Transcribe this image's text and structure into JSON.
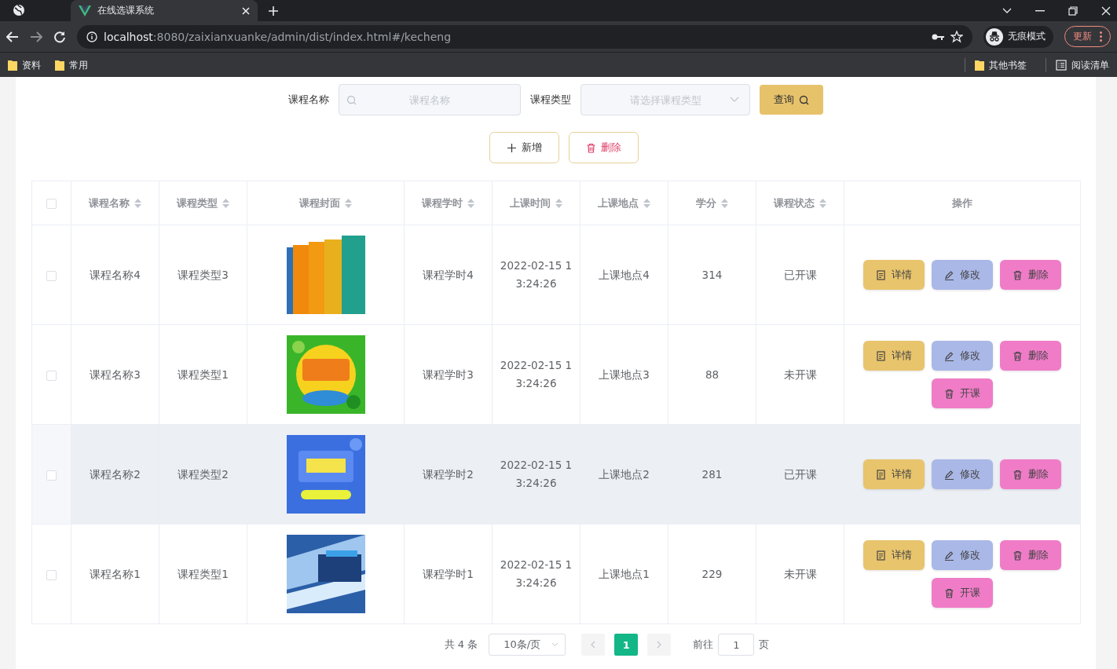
{
  "browser": {
    "tab_title": "在线选课系统",
    "url_host": "localhost",
    "url_path": ":8080/zaixianxuanke/admin/dist/index.html#/kecheng",
    "incognito_label": "无痕模式",
    "update_button": "更新",
    "bookmarks": [
      "资料",
      "常用"
    ],
    "other_bookmarks": "其他书签",
    "reading_list": "阅读清单"
  },
  "search": {
    "fields": [
      {
        "label": "课程名称",
        "placeholder": "课程名称",
        "kind": "text"
      },
      {
        "label": "课程类型",
        "placeholder": "请选择课程类型",
        "kind": "select"
      }
    ],
    "query_button": "查询"
  },
  "actions": [
    {
      "label": "新增",
      "kind": "add"
    },
    {
      "label": "删除",
      "kind": "delete"
    }
  ],
  "table": {
    "select_all": {
      "checked": false
    },
    "columns": [
      {
        "label": "课程名称",
        "kind": "text",
        "sortable": true
      },
      {
        "label": "课程类型",
        "kind": "text",
        "sortable": true
      },
      {
        "label": "课程封面",
        "kind": "picture",
        "sortable": true
      },
      {
        "label": "课程学时",
        "kind": "text",
        "sortable": true
      },
      {
        "label": "上课时间",
        "kind": "text",
        "sortable": true
      },
      {
        "label": "上课地点",
        "kind": "text",
        "sortable": true
      },
      {
        "label": "学分",
        "kind": "text",
        "sortable": true
      },
      {
        "label": "课程状态",
        "kind": "text",
        "sortable": true
      },
      {
        "label": "操作",
        "kind": "actions",
        "sortable": false
      }
    ],
    "rows": [
      {
        "checked": false,
        "highlighted": false,
        "cells": [
          "课程名称4",
          "课程类型3",
          {
            "kind": "picture"
          },
          "课程学时4",
          "2022-02-15 13:24:26",
          "上课地点4",
          "314",
          "已开课"
        ],
        "actions": [
          {
            "label": "详情",
            "kind": "detail"
          },
          {
            "label": "修改",
            "kind": "edit"
          },
          {
            "label": "删除",
            "kind": "delete"
          }
        ]
      },
      {
        "checked": false,
        "highlighted": false,
        "cells": [
          "课程名称3",
          "课程类型1",
          {
            "kind": "picture"
          },
          "课程学时3",
          "2022-02-15 13:24:26",
          "上课地点3",
          "88",
          "未开课"
        ],
        "actions": [
          {
            "label": "详情",
            "kind": "detail"
          },
          {
            "label": "修改",
            "kind": "edit"
          },
          {
            "label": "删除",
            "kind": "delete"
          },
          {
            "label": "开课",
            "kind": "open"
          }
        ]
      },
      {
        "checked": false,
        "highlighted": true,
        "cells": [
          "课程名称2",
          "课程类型2",
          {
            "kind": "picture"
          },
          "课程学时2",
          "2022-02-15 13:24:26",
          "上课地点2",
          "281",
          "已开课"
        ],
        "actions": [
          {
            "label": "详情",
            "kind": "detail"
          },
          {
            "label": "修改",
            "kind": "edit"
          },
          {
            "label": "删除",
            "kind": "delete"
          }
        ]
      },
      {
        "checked": false,
        "highlighted": false,
        "cells": [
          "课程名称1",
          "课程类型1",
          {
            "kind": "picture"
          },
          "课程学时1",
          "2022-02-15 13:24:26",
          "上课地点1",
          "229",
          "未开课"
        ],
        "actions": [
          {
            "label": "详情",
            "kind": "detail"
          },
          {
            "label": "修改",
            "kind": "edit"
          },
          {
            "label": "删除",
            "kind": "delete"
          },
          {
            "label": "开课",
            "kind": "open"
          }
        ]
      }
    ]
  },
  "pagination": {
    "total": "共 4 条",
    "page_size": "10条/页",
    "pages": [
      {
        "label": "1",
        "selected": true
      }
    ],
    "goto_label": "前往",
    "goto_value": "1",
    "page_suffix": "页"
  }
}
